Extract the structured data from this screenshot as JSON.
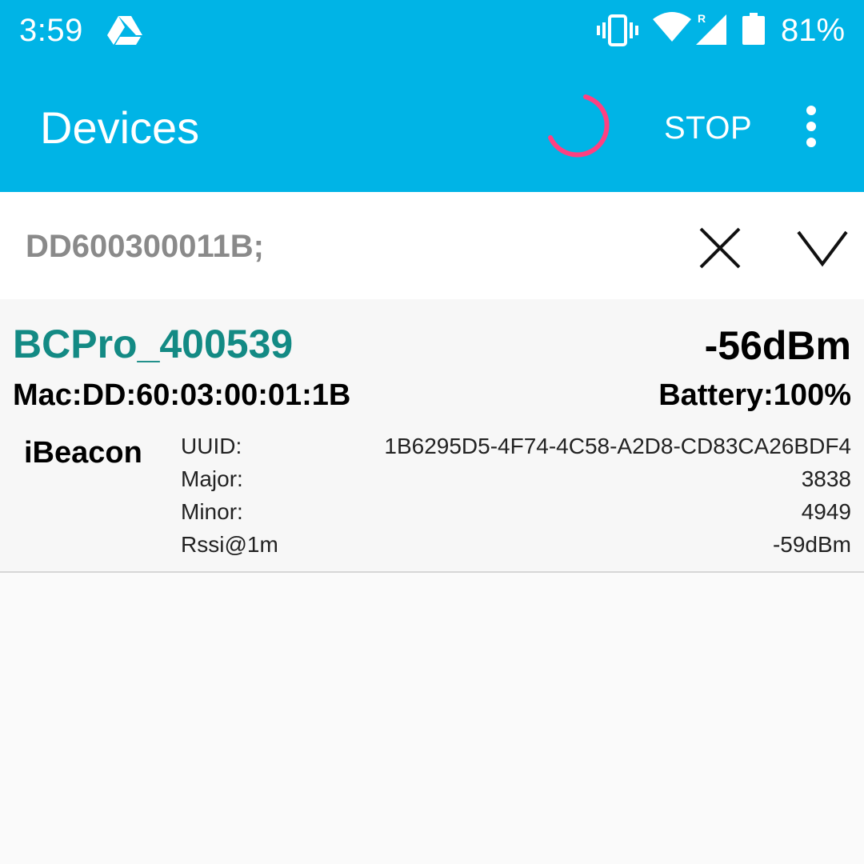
{
  "statusbar": {
    "time": "3:59",
    "battery_percent": "81%",
    "signal_badge": "R",
    "icons": [
      "google-drive-icon",
      "vibrate-icon",
      "wifi-icon",
      "cell-signal-icon",
      "battery-icon"
    ]
  },
  "appbar": {
    "title": "Devices",
    "stop_label": "STOP",
    "icons": [
      "progress-spinner-icon",
      "more-vert-icon"
    ],
    "accent_color": "#00b4e6",
    "spinner_color": "#ff4081"
  },
  "filter": {
    "value": "DD600300011B;",
    "icons": [
      "close-icon",
      "chevron-down-icon"
    ]
  },
  "devices": [
    {
      "name": "BCPro_400539",
      "rssi": "-56dBm",
      "mac": "Mac:DD:60:03:00:01:1B",
      "battery": "Battery:100%",
      "beacon_type": "iBeacon",
      "name_color": "#138a84",
      "fields": [
        {
          "key": "UUID:",
          "value": "1B6295D5-4F74-4C58-A2D8-CD83CA26BDF4"
        },
        {
          "key": "Major:",
          "value": "3838"
        },
        {
          "key": "Minor:",
          "value": "4949"
        },
        {
          "key": "Rssi@1m",
          "value": "-59dBm"
        }
      ]
    }
  ]
}
